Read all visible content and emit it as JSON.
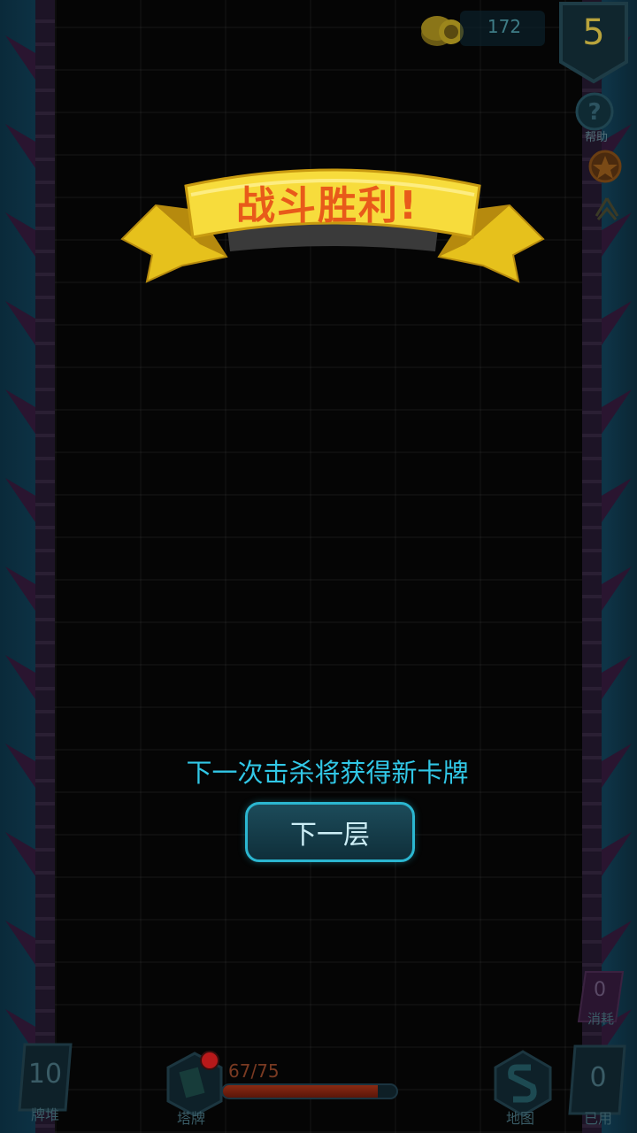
{
  "hud": {
    "coins": "172",
    "level": "5",
    "help_label": "帮助"
  },
  "banner": {
    "title": "战斗胜利!"
  },
  "result": {
    "info": "下一次击杀将获得新卡牌",
    "next_button": "下一层"
  },
  "bottom": {
    "deck_count": "10",
    "deck_label": "牌堆",
    "tower_label": "塔牌",
    "hp_text": "67/75",
    "hp_current": 67,
    "hp_max": 75,
    "map_label": "地图",
    "consume_count": "0",
    "consume_label": "消耗",
    "used_count": "0",
    "used_label": "已用"
  },
  "colors": {
    "accent": "#31c7e6",
    "banner_gold": "#f4d43a",
    "banner_text": "#e85a1a",
    "hp": "#8a2a12"
  }
}
